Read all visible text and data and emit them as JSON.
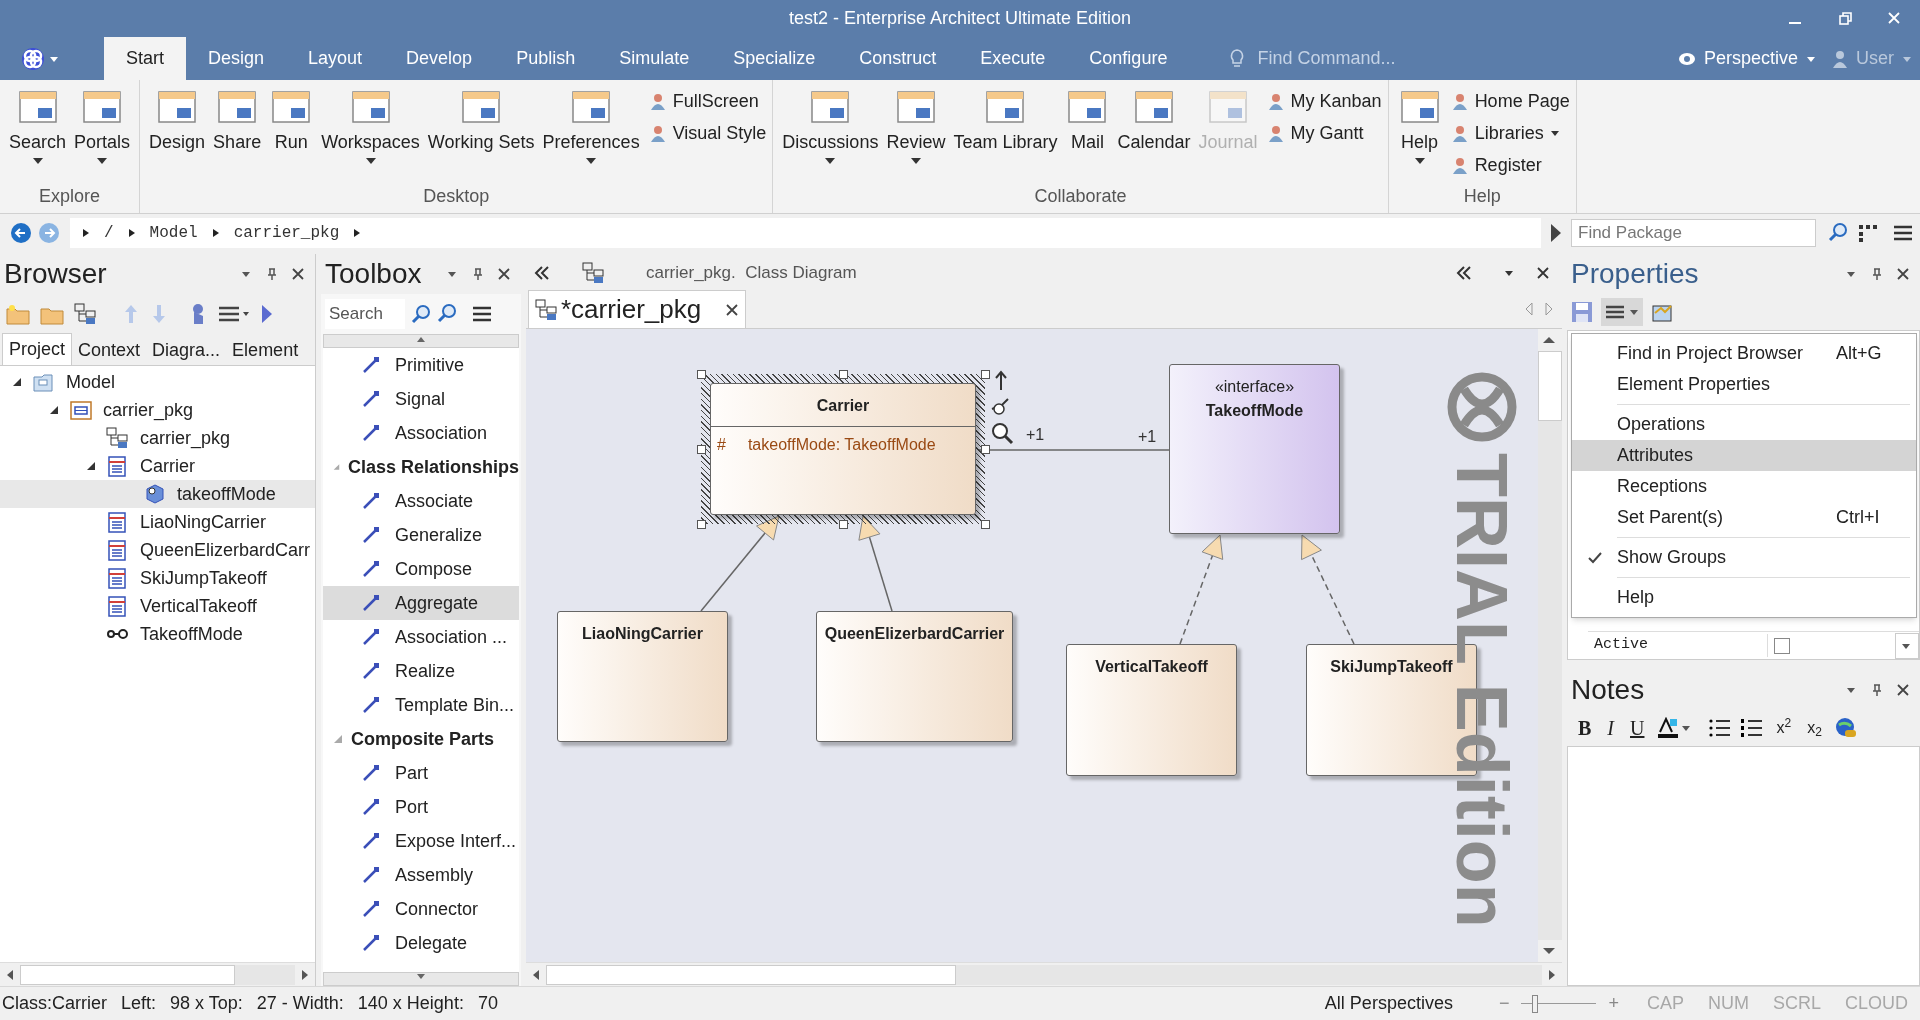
{
  "window": {
    "title": "test2 - Enterprise Architect Ultimate Edition"
  },
  "menu_tabs": [
    {
      "label": "Start",
      "selected": true
    },
    {
      "label": "Design",
      "selected": false
    },
    {
      "label": "Layout",
      "selected": false
    },
    {
      "label": "Develop",
      "selected": false
    },
    {
      "label": "Publish",
      "selected": false
    },
    {
      "label": "Simulate",
      "selected": false
    },
    {
      "label": "Specialize",
      "selected": false
    },
    {
      "label": "Construct",
      "selected": false
    },
    {
      "label": "Execute",
      "selected": false
    },
    {
      "label": "Configure",
      "selected": false
    }
  ],
  "find_command": {
    "placeholder": "Find Command..."
  },
  "perspective": {
    "label": "Perspective"
  },
  "user": {
    "label": "User"
  },
  "ribbon": [
    {
      "label": "Explore",
      "buttons": [
        {
          "kind": "large",
          "label": "Search",
          "menu": true,
          "disabled": false
        },
        {
          "kind": "large",
          "label": "Portals",
          "menu": true,
          "disabled": false
        }
      ]
    },
    {
      "label": "Desktop",
      "buttons": [
        {
          "kind": "large",
          "label": "Design",
          "menu": false,
          "disabled": false
        },
        {
          "kind": "large",
          "label": "Share",
          "menu": false,
          "disabled": false
        },
        {
          "kind": "large",
          "label": "Run",
          "menu": false,
          "disabled": false
        },
        {
          "kind": "large",
          "label": "Workspaces",
          "menu": true,
          "disabled": false
        },
        {
          "kind": "large",
          "label": "Working Sets",
          "menu": false,
          "disabled": false
        },
        {
          "kind": "large",
          "label": "Preferences",
          "menu": true,
          "disabled": false
        },
        {
          "kind": "small",
          "label": "FullScreen",
          "menu": false,
          "disabled": false
        },
        {
          "kind": "small",
          "label": "Visual Style",
          "menu": false,
          "disabled": false
        }
      ]
    },
    {
      "label": "Collaborate",
      "buttons": [
        {
          "kind": "large",
          "label": "Discussions",
          "menu": true,
          "disabled": false
        },
        {
          "kind": "large",
          "label": "Review",
          "menu": true,
          "disabled": false
        },
        {
          "kind": "large",
          "label": "Team Library",
          "menu": false,
          "disabled": false
        },
        {
          "kind": "large",
          "label": "Mail",
          "menu": false,
          "disabled": false
        },
        {
          "kind": "large",
          "label": "Calendar",
          "menu": false,
          "disabled": false
        },
        {
          "kind": "large",
          "label": "Journal",
          "menu": false,
          "disabled": true
        },
        {
          "kind": "small",
          "label": "My Kanban",
          "menu": false,
          "disabled": false
        },
        {
          "kind": "small",
          "label": "My Gantt",
          "menu": false,
          "disabled": false
        }
      ]
    },
    {
      "label": "Help",
      "buttons": [
        {
          "kind": "large",
          "label": "Help",
          "menu": true,
          "disabled": false
        },
        {
          "kind": "small",
          "label": "Home Page",
          "menu": false,
          "disabled": false
        },
        {
          "kind": "small",
          "label": "Libraries",
          "menu": true,
          "disabled": false
        },
        {
          "kind": "small",
          "label": "Register",
          "menu": false,
          "disabled": false
        }
      ]
    }
  ],
  "breadcrumb": [
    "/",
    "Model",
    "carrier_pkg"
  ],
  "find_package": {
    "placeholder": "Find Package"
  },
  "browser": {
    "title": "Browser",
    "tabs": [
      {
        "label": "Project",
        "selected": true
      },
      {
        "label": "Context",
        "selected": false
      },
      {
        "label": "Diagra...",
        "selected": false
      },
      {
        "label": "Element",
        "selected": false
      }
    ],
    "tree": [
      {
        "label": "Model",
        "kind": "model",
        "expanded": true,
        "selected": false,
        "children": [
          {
            "label": "carrier_pkg",
            "kind": "package",
            "expanded": true,
            "selected": false,
            "children": [
              {
                "label": "carrier_pkg",
                "kind": "diagram",
                "selected": false
              },
              {
                "label": "Carrier",
                "kind": "class",
                "expanded": true,
                "selected": false,
                "children": [
                  {
                    "label": "takeoffMode",
                    "kind": "attribute",
                    "selected": true
                  }
                ]
              },
              {
                "label": "LiaoNingCarrier",
                "kind": "class",
                "selected": false
              },
              {
                "label": "QueenElizerbardCarr",
                "kind": "class",
                "selected": false
              },
              {
                "label": "SkiJumpTakeoff",
                "kind": "class",
                "selected": false
              },
              {
                "label": "VerticalTakeoff",
                "kind": "class",
                "selected": false
              },
              {
                "label": "TakeoffMode",
                "kind": "interface",
                "selected": false
              }
            ]
          }
        ]
      }
    ]
  },
  "toolbox": {
    "title": "Toolbox",
    "search": {
      "placeholder": "Search"
    },
    "items": [
      {
        "kind": "tool",
        "label": "Primitive",
        "selected": false
      },
      {
        "kind": "tool",
        "label": "Signal",
        "selected": false
      },
      {
        "kind": "tool",
        "label": "Association",
        "selected": false
      },
      {
        "kind": "section",
        "label": "Class Relationships",
        "expanded": true
      },
      {
        "kind": "tool",
        "label": "Associate",
        "selected": false
      },
      {
        "kind": "tool",
        "label": "Generalize",
        "selected": false
      },
      {
        "kind": "tool",
        "label": "Compose",
        "selected": false
      },
      {
        "kind": "tool",
        "label": "Aggregate",
        "selected": true
      },
      {
        "kind": "tool",
        "label": "Association ...",
        "selected": false
      },
      {
        "kind": "tool",
        "label": "Realize",
        "selected": false
      },
      {
        "kind": "tool",
        "label": "Template Bin...",
        "selected": false
      },
      {
        "kind": "section",
        "label": "Composite Parts",
        "expanded": true
      },
      {
        "kind": "tool",
        "label": "Part",
        "selected": false
      },
      {
        "kind": "tool",
        "label": "Port",
        "selected": false
      },
      {
        "kind": "tool",
        "label": "Expose Interf...",
        "selected": false
      },
      {
        "kind": "tool",
        "label": "Assembly",
        "selected": false
      },
      {
        "kind": "tool",
        "label": "Connector",
        "selected": false
      },
      {
        "kind": "tool",
        "label": "Delegate",
        "selected": false
      }
    ]
  },
  "diagram": {
    "header": "carrier_pkg.  Class Diagram",
    "tab": "*carrier_pkg",
    "elements": [
      {
        "kind": "class",
        "name": "Carrier",
        "selected": true,
        "attributes": [
          {
            "visibility": "#",
            "text": "takeoffMode: TakeoffMode"
          }
        ]
      },
      {
        "kind": "interface",
        "name": "TakeoffMode",
        "stereotype": "«interface»",
        "selected": false
      },
      {
        "kind": "class",
        "name": "LiaoNingCarrier",
        "selected": false
      },
      {
        "kind": "class",
        "name": "QueenElizerbardCarrier",
        "selected": false
      },
      {
        "kind": "class",
        "name": "VerticalTakeoff",
        "selected": false
      },
      {
        "kind": "class",
        "name": "SkiJumpTakeoff",
        "selected": false
      }
    ],
    "connectors": [
      {
        "kind": "generalization"
      },
      {
        "kind": "generalization"
      },
      {
        "kind": "realization"
      },
      {
        "kind": "realization"
      },
      {
        "kind": "association",
        "source_label": "+1",
        "target_label": "+1"
      }
    ],
    "watermark": "TRIAL Edition"
  },
  "properties": {
    "title": "Properties",
    "menu_groups": [
      {
        "items": [
          {
            "label": "Find in Project Browser",
            "shortcut": "Alt+G",
            "checked": false,
            "selected": false
          },
          {
            "label": "Element Properties",
            "checked": false,
            "selected": false
          }
        ]
      },
      {
        "items": [
          {
            "label": "Operations",
            "checked": false,
            "selected": false
          },
          {
            "label": "Attributes",
            "checked": false,
            "selected": true
          },
          {
            "label": "Receptions",
            "checked": false,
            "selected": false
          },
          {
            "label": "Set Parent(s)",
            "shortcut": "Ctrl+I",
            "checked": false,
            "selected": false
          }
        ]
      },
      {
        "items": [
          {
            "label": "Show Groups",
            "checked": true,
            "selected": false
          }
        ]
      },
      {
        "items": [
          {
            "label": "Help",
            "checked": false,
            "selected": false
          }
        ]
      }
    ],
    "fields": [
      {
        "label": "Active",
        "checked": false
      }
    ]
  },
  "notes": {
    "title": "Notes",
    "format_buttons": [
      "B",
      "I",
      "U",
      "x$^{2}$",
      "x$_{2}$"
    ]
  },
  "status_bar": {
    "fields": [
      "Class:Carrier",
      "Left:",
      "98 x Top:",
      "27 - Width:",
      "140 x Height:",
      "70"
    ],
    "perspectives": "All Perspectives",
    "zoom_out": "−",
    "zoom": {
      "level": 0.15
    },
    "zoom_in": "+",
    "indicators": [
      {
        "label": "CAP",
        "on": false
      },
      {
        "label": "NUM",
        "on": false
      },
      {
        "label": "SCRL",
        "on": false
      },
      {
        "label": "CLOUD",
        "on": false
      }
    ]
  }
}
